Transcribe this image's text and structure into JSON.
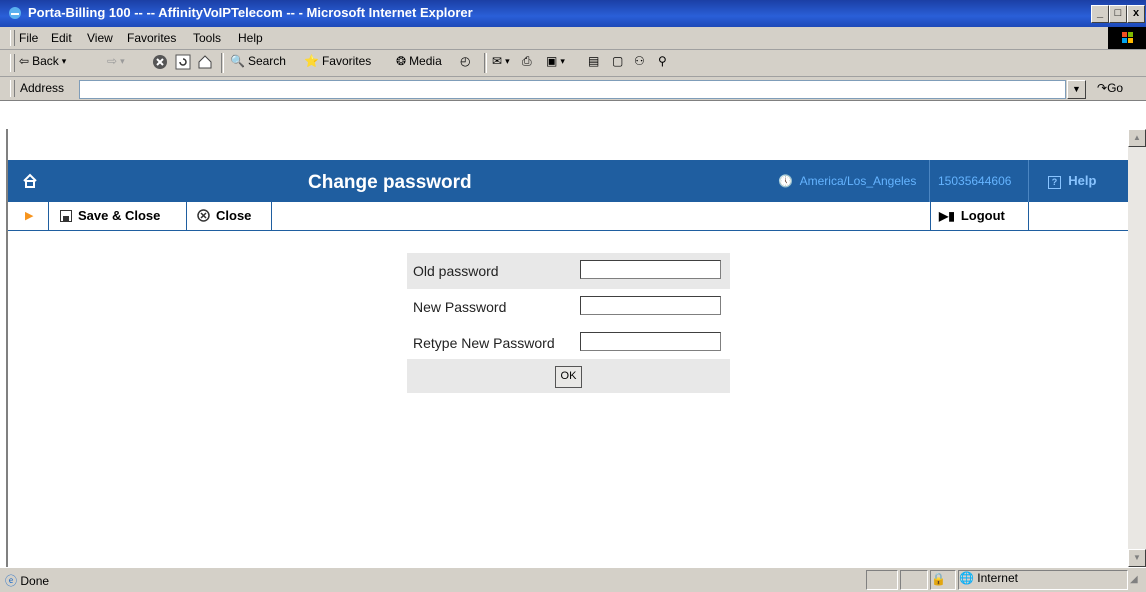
{
  "window": {
    "title": "Porta-Billing 100 -- -- AffinityVoIPTelecom -- - Microsoft Internet Explorer",
    "controls": [
      "_",
      "□",
      "x"
    ]
  },
  "menubar": {
    "items": [
      "File",
      "Edit",
      "View",
      "Favorites",
      "Tools",
      "Help"
    ]
  },
  "toolbar": {
    "back": "Back",
    "search": "Search",
    "favorites": "Favorites",
    "media": "Media"
  },
  "address": {
    "label": "Address",
    "value": "",
    "go": "Go"
  },
  "header": {
    "title": "Change password",
    "timezone": "America/Los_Angeles",
    "phone": "15035644606",
    "help": "Help",
    "color": "#1f5ea0"
  },
  "actions": {
    "save_close": "Save & Close",
    "close": "Close",
    "logout": "Logout"
  },
  "form": {
    "old_password_label": "Old password",
    "new_password_label": "New Password",
    "retype_label": "Retype New Password",
    "old_password_value": "",
    "new_password_value": "",
    "retype_value": "",
    "ok": "OK"
  },
  "status": {
    "text": "Done",
    "zone": "Internet"
  }
}
